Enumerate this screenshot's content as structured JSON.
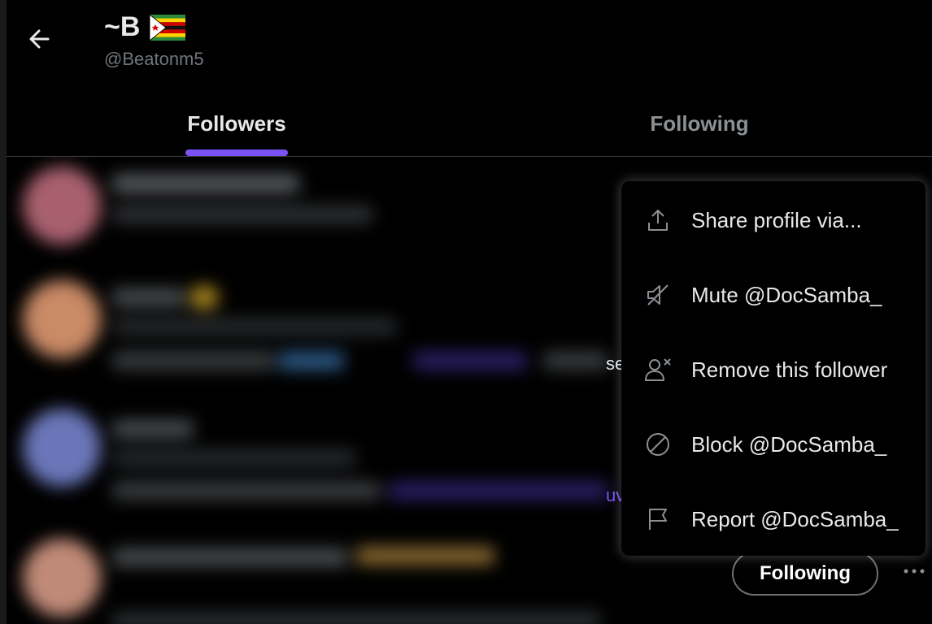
{
  "header": {
    "display_name": "~B",
    "handle": "@Beatonm5",
    "flag_icon": "zimbabwe-flag-icon"
  },
  "tabs": [
    {
      "label": "Followers",
      "active": true
    },
    {
      "label": "Following",
      "active": false
    }
  ],
  "colors": {
    "accent": "#7b53f5",
    "background": "#000000",
    "text": "#e7e9ea",
    "muted": "#71767b"
  },
  "follower_row": {
    "following_label": "Following",
    "more_icon": "more-horizontal-icon"
  },
  "peek_text": {
    "row2": "se",
    "row3": "uv"
  },
  "context_menu": {
    "items": [
      {
        "label": "Share profile via...",
        "icon": "share-icon"
      },
      {
        "label": "Mute @DocSamba_",
        "icon": "mute-icon"
      },
      {
        "label": "Remove this follower",
        "icon": "remove-follower-icon"
      },
      {
        "label": "Block @DocSamba_",
        "icon": "block-icon"
      },
      {
        "label": "Report @DocSamba_",
        "icon": "report-flag-icon"
      }
    ]
  }
}
